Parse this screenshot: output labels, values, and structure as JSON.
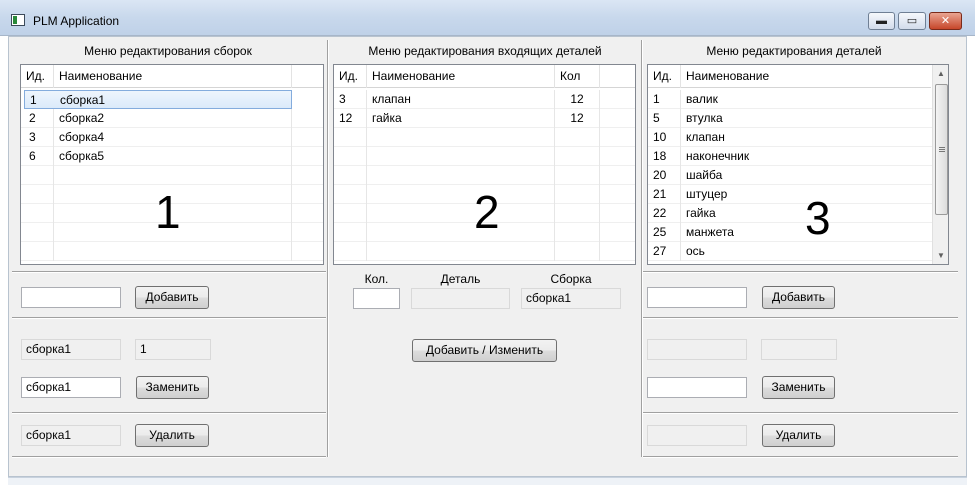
{
  "window": {
    "title": "PLM Application",
    "buttons": {
      "minimize": "▬",
      "maximize": "▭",
      "close": "✕"
    }
  },
  "assemblies_panel": {
    "title": "Меню редактирования сборок",
    "columns": [
      "Ид.",
      "Наименование"
    ],
    "rows": [
      {
        "id": "1",
        "name": "сборка1",
        "selected": true
      },
      {
        "id": "2",
        "name": "сборка2"
      },
      {
        "id": "3",
        "name": "сборка4"
      },
      {
        "id": "6",
        "name": "сборка5"
      }
    ],
    "overlay_number": "1",
    "add_input": "",
    "add_button": "Добавить",
    "selected_name": "сборка1",
    "selected_id": "1",
    "replace_input": "сборка1",
    "replace_button": "Заменить",
    "delete_name": "сборка1",
    "delete_button": "Удалить"
  },
  "incoming_panel": {
    "title": "Меню редактирования входящих деталей",
    "columns": [
      "Ид.",
      "Наименование",
      "Кол"
    ],
    "rows": [
      {
        "id": "3",
        "name": "клапан",
        "qty": "12"
      },
      {
        "id": "12",
        "name": "гайка",
        "qty": "12"
      }
    ],
    "overlay_number": "2",
    "qty_label": "Кол.",
    "part_label": "Деталь",
    "assembly_label": "Сборка",
    "qty_input": "",
    "part_value": "",
    "assembly_value": "сборка1",
    "add_change_button": "Добавить / Изменить"
  },
  "parts_panel": {
    "title": "Меню редактирования деталей",
    "columns": [
      "Ид.",
      "Наименование"
    ],
    "rows": [
      {
        "id": "1",
        "name": "валик"
      },
      {
        "id": "5",
        "name": "втулка"
      },
      {
        "id": "10",
        "name": "клапан"
      },
      {
        "id": "18",
        "name": "наконечник"
      },
      {
        "id": "20",
        "name": "шайба"
      },
      {
        "id": "21",
        "name": "штуцер"
      },
      {
        "id": "22",
        "name": "гайка"
      },
      {
        "id": "25",
        "name": "манжета"
      },
      {
        "id": "27",
        "name": "ось"
      }
    ],
    "overlay_number": "3",
    "add_input": "",
    "add_button": "Добавить",
    "selected_name": "",
    "selected_id": "",
    "replace_input": "",
    "replace_button": "Заменить",
    "delete_name": "",
    "delete_button": "Удалить"
  }
}
